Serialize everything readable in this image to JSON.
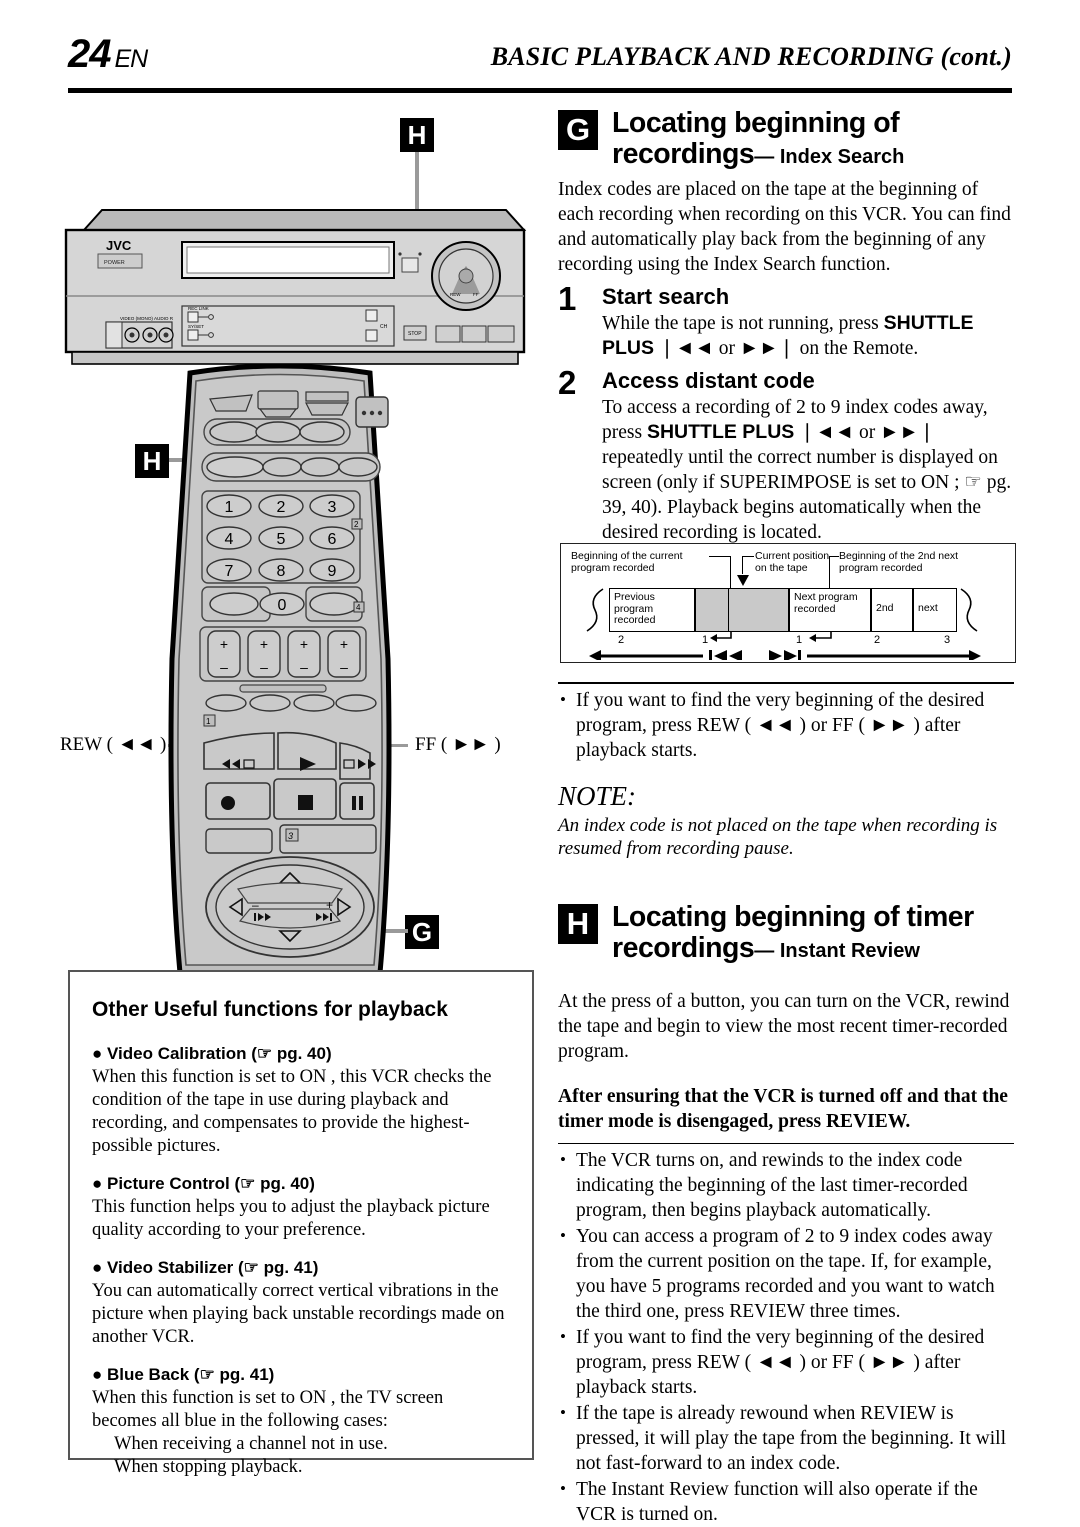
{
  "header": {
    "page_number": "24",
    "lang": "EN",
    "title": "BASIC PLAYBACK AND RECORDING (cont.)"
  },
  "figures": {
    "vcr": {
      "brand": "JVC",
      "power_label": "POWER",
      "jack_label": "VIDEO  (MONO) AUDIO   R",
      "reclink_label": "REC LINK",
      "sysset_label": "SY/SET",
      "ch_label": "CH",
      "stop_label": "STOP",
      "marker": "H"
    },
    "remote": {
      "marker_upper": "H",
      "marker_lower": "G",
      "keys": [
        "1",
        "2",
        "3",
        "4",
        "5",
        "6",
        "7",
        "8",
        "9",
        "0"
      ],
      "plus": "+",
      "minus": "−",
      "callout_rew": "REW ( ◄◄ )",
      "callout_ff": "FF ( ►► )",
      "tags": [
        "1",
        "2",
        "3",
        "4"
      ]
    }
  },
  "sections": {
    "g": {
      "badge": "G",
      "title_line1": "Locating beginning of",
      "title_line2": "recordings",
      "title_sub": "— Index Search",
      "intro": "Index codes are placed on the tape at the beginning of each recording when recording on this VCR. You can find and automatically play back from the beginning of any recording using the Index Search function.",
      "steps": [
        {
          "num": "1",
          "title": "Start search",
          "body_pre": "While the tape is not running, press ",
          "body_bold": "SHUTTLE PLUS",
          "body_post": " ❘◄◄ or ►►❘  on the Remote."
        },
        {
          "num": "2",
          "title": "Access distant code",
          "body_pre": "To access a recording of 2 to 9 index codes away, press ",
          "body_bold": "SHUTTLE PLUS",
          "body_post": " ❘◄◄ or ►►❘ repeatedly until the correct number is displayed on screen (only if  SUPERIMPOSE  is set to  ON  ; ☞ pg. 39, 40). Playback begins automatically when the desired recording is located."
        }
      ],
      "bullet": "If you want to find the very beginning of the desired program, press REW ( ◄◄ ) or FF ( ►► ) after playback starts.",
      "note_head": "NOTE:",
      "note_body": "An index code is not placed on the tape when recording is resumed from recording pause."
    },
    "h": {
      "badge": "H",
      "title_line1": "Locating beginning of timer",
      "title_line2": "recordings",
      "title_sub": "— Instant Review",
      "intro": "At the press of a button, you can turn on the VCR, rewind the tape and begin to view the most recent timer-recorded program.",
      "emphasis": "After ensuring that the VCR is turned off and that the timer mode is disengaged, press REVIEW.",
      "bullets": [
        "The VCR turns on, and rewinds to the index code indicating the beginning of the last timer-recorded program, then begins playback automatically.",
        "You can access a program of 2 to 9 index codes away from the current position on the tape. If, for example, you have 5 programs recorded and you want to watch the third one, press REVIEW three times.",
        "If you want to find the very beginning of the desired program, press REW ( ◄◄ ) or FF ( ►► ) after playback starts.",
        "If the tape is already rewound when REVIEW is pressed, it will play the tape from the beginning. It will not fast-forward to an index code.",
        "The Instant Review function will also operate if the VCR is turned on."
      ]
    }
  },
  "diagram": {
    "label_left": "Beginning of the current\nprogram recorded",
    "label_mid": "Current position\non the tape",
    "label_right": "Beginning of the 2nd next\nprogram recorded",
    "segments": [
      {
        "text": "Previous\nprogram\nrecorded",
        "shaded": false
      },
      {
        "text": "",
        "shaded": true
      },
      {
        "text": "Next\nprogram\nrecorded",
        "shaded": false
      },
      {
        "text": "2nd",
        "shaded": false
      },
      {
        "text": "next",
        "shaded": false
      }
    ],
    "ticks": [
      "2",
      "1",
      "1",
      "2",
      "3"
    ],
    "arrow_left_icon": "❘◄◄",
    "arrow_right_icon": "►►❘"
  },
  "useful": {
    "title": "Other Useful functions for playback",
    "items": [
      {
        "head": "● Video Calibration (☞ pg. 40)",
        "body": "When this function is set to  ON , this VCR checks the condition of the tape in use during playback and recording, and compensates to provide the highest-possible pictures."
      },
      {
        "head": "● Picture Control (☞ pg. 40)",
        "body": "This function helps you to adjust the playback picture quality according to your preference."
      },
      {
        "head": "● Video Stabilizer (☞ pg. 41)",
        "body": "You can automatically correct vertical vibrations in the picture when playing back unstable recordings made on another VCR."
      },
      {
        "head": "● Blue Back (☞ pg. 41)",
        "body": "When this function is set to  ON , the TV screen becomes all blue in the following cases:",
        "sub": [
          "When receiving a channel not in use.",
          "When stopping playback."
        ]
      }
    ]
  }
}
